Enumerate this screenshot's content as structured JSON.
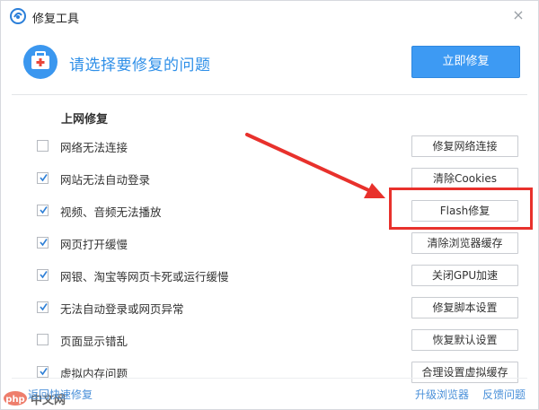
{
  "window": {
    "title": "修复工具",
    "close_glyph": "×"
  },
  "header": {
    "title": "请选择要修复的问题",
    "repair_now_label": "立即修复",
    "accent_color": "#3d9af3"
  },
  "section": {
    "title": "上网修复"
  },
  "rows": [
    {
      "label": "网络无法连接",
      "checked": false,
      "action": "修复网络连接"
    },
    {
      "label": "网站无法自动登录",
      "checked": true,
      "action": "清除Cookies"
    },
    {
      "label": "视频、音频无法播放",
      "checked": true,
      "action": "Flash修复"
    },
    {
      "label": "网页打开缓慢",
      "checked": true,
      "action": "清除浏览器缓存"
    },
    {
      "label": "网银、淘宝等网页卡死或运行缓慢",
      "checked": true,
      "action": "关闭GPU加速"
    },
    {
      "label": "无法自动登录或网页异常",
      "checked": true,
      "action": "修复脚本设置"
    },
    {
      "label": "页面显示错乱",
      "checked": false,
      "action": "恢复默认设置"
    },
    {
      "label": "虚拟内存问题",
      "checked": true,
      "action": "合理设置虚拟缓存"
    }
  ],
  "footer": {
    "back_link": "返回快速修复",
    "upgrade_link": "升级浏览器",
    "feedback_link": "反馈问题"
  },
  "watermark": {
    "text": "中文网"
  },
  "annotation": {
    "highlight_color": "#e8312c"
  }
}
